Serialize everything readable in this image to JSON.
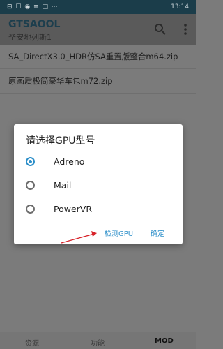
{
  "status_bar": {
    "left": "⊟ ☐ ◉ ≡ □ ⋯",
    "time": "13:14"
  },
  "app_bar": {
    "title": "GTSAOOL",
    "subtitle": "圣安地列斯1"
  },
  "files": [
    "SA_DirectX3.0_HDR仿SA重置版整合m64.zip",
    "原画质极简豪华车包m72.zip"
  ],
  "dialog": {
    "title": "请选择GPU型号",
    "options": [
      {
        "label": "Adreno",
        "checked": true
      },
      {
        "label": "Mail",
        "checked": false
      },
      {
        "label": "PowerVR",
        "checked": false
      }
    ],
    "detect_button": "检测GPU",
    "confirm_button": "确定"
  },
  "bottom_nav": {
    "tabs": [
      "资源",
      "功能",
      "MOD"
    ],
    "active": "MOD"
  },
  "colors": {
    "accent": "#2d8fc9",
    "arrow": "#d8232a"
  }
}
